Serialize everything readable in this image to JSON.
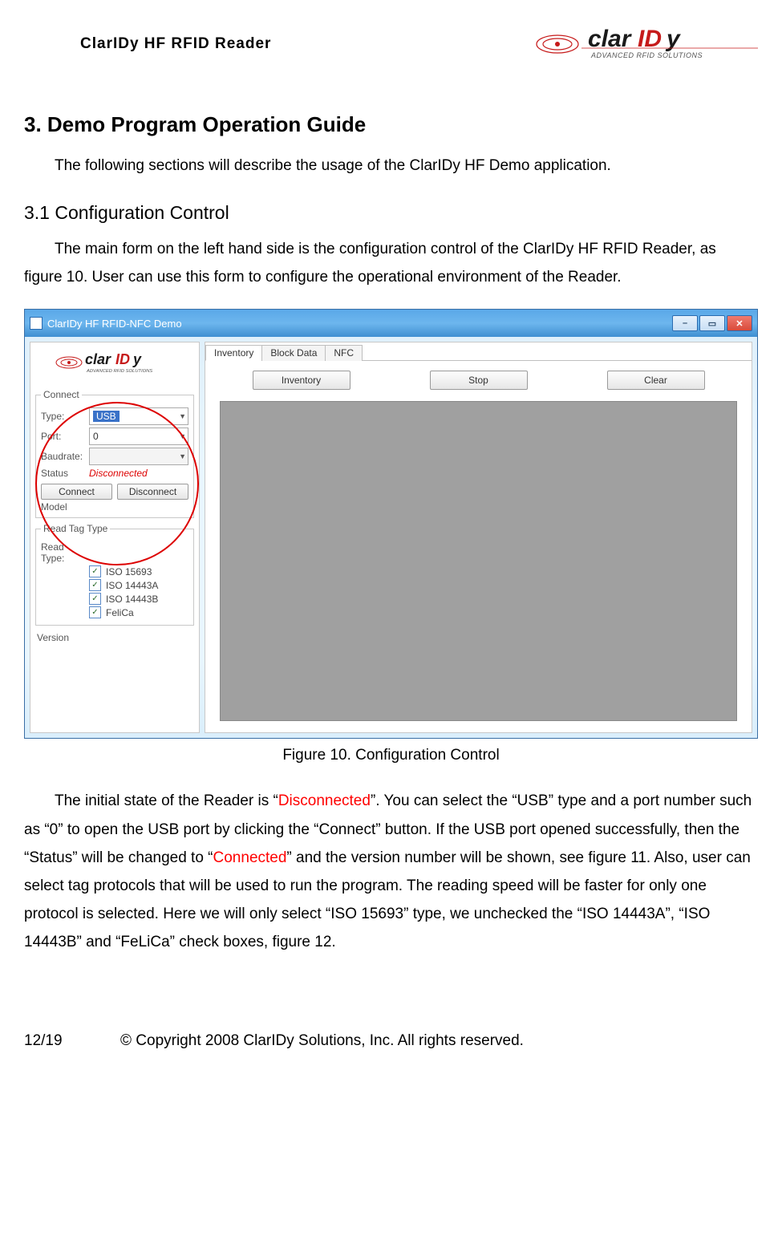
{
  "header": {
    "product": "ClarIDy  HF  RFID  Reader",
    "logo_main": "clarIDy",
    "logo_sub": "ADVANCED RFID SOLUTIONS"
  },
  "doc": {
    "h2": "3. Demo Program Operation Guide",
    "p1": "The following sections will describe the usage of the ClarIDy HF Demo application.",
    "h3": "3.1 Configuration Control",
    "p2": "The main form on the left hand side is the configuration control of the ClarIDy HF RFID Reader, as figure 10. User can use this form to configure the operational environment of the Reader.",
    "fig_caption": "Figure 10. Configuration Control",
    "p3a": "The initial state of the Reader is “",
    "p3b": "Disconnected",
    "p3c": "”. You can select the “USB” type and a port number such as “0” to open the USB port by clicking the “Connect” button. If the USB port opened successfully, then the “Status” will be changed to “",
    "p3d": "Connected",
    "p3e": "” and the version number will be shown, see figure 11. Also, user can select tag protocols that will be used to run the program. The reading speed will be faster for only one protocol is selected. Here we will only select “ISO 15693” type, we unchecked the “ISO 14443A”, “ISO 14443B” and “FeLiCa” check boxes, figure 12."
  },
  "footer": {
    "page": "12/19",
    "copy": "© Copyright 2008 ClarIDy Solutions, Inc. All rights reserved."
  },
  "app": {
    "title": "ClarIDy HF RFID-NFC Demo",
    "connect_legend": "Connect",
    "type_label": "Type:",
    "type_value": "USB",
    "port_label": "Port:",
    "port_value": "0",
    "baud_label": "Baudrate:",
    "baud_value": "",
    "status_label": "Status",
    "status_value": "Disconnected",
    "connect_btn": "Connect",
    "disconnect_btn": "Disconnect",
    "model_label": "Model",
    "readtag_legend": "Read Tag Type",
    "readtype_label": "Read Type:",
    "chk1": "ISO 15693",
    "chk2": "ISO 14443A",
    "chk3": "ISO 14443B",
    "chk4": "FeliCa",
    "version_label": "Version",
    "tabs": {
      "t1": "Inventory",
      "t2": "Block Data",
      "t3": "NFC"
    },
    "btns": {
      "inv": "Inventory",
      "stop": "Stop",
      "clear": "Clear"
    }
  }
}
